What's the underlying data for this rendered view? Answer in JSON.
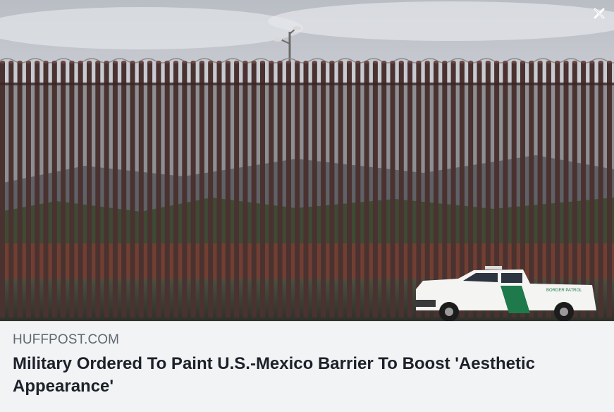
{
  "link_preview": {
    "domain": "HUFFPOST.COM",
    "headline": "Military Ordered To Paint U.S.-Mexico Barrier To Boost 'Aesthetic Appearance'",
    "image": {
      "subject": "border-fence-photo",
      "vehicle_text": "BORDER PATROL"
    },
    "close_icon": "close-icon"
  },
  "colors": {
    "sky": "#c9ccd2",
    "bollard": "#4a3230",
    "truck_green": "#1e7a4a",
    "domain_text": "#606770",
    "headline_text": "#1d2129",
    "background": "#f2f3f5"
  }
}
